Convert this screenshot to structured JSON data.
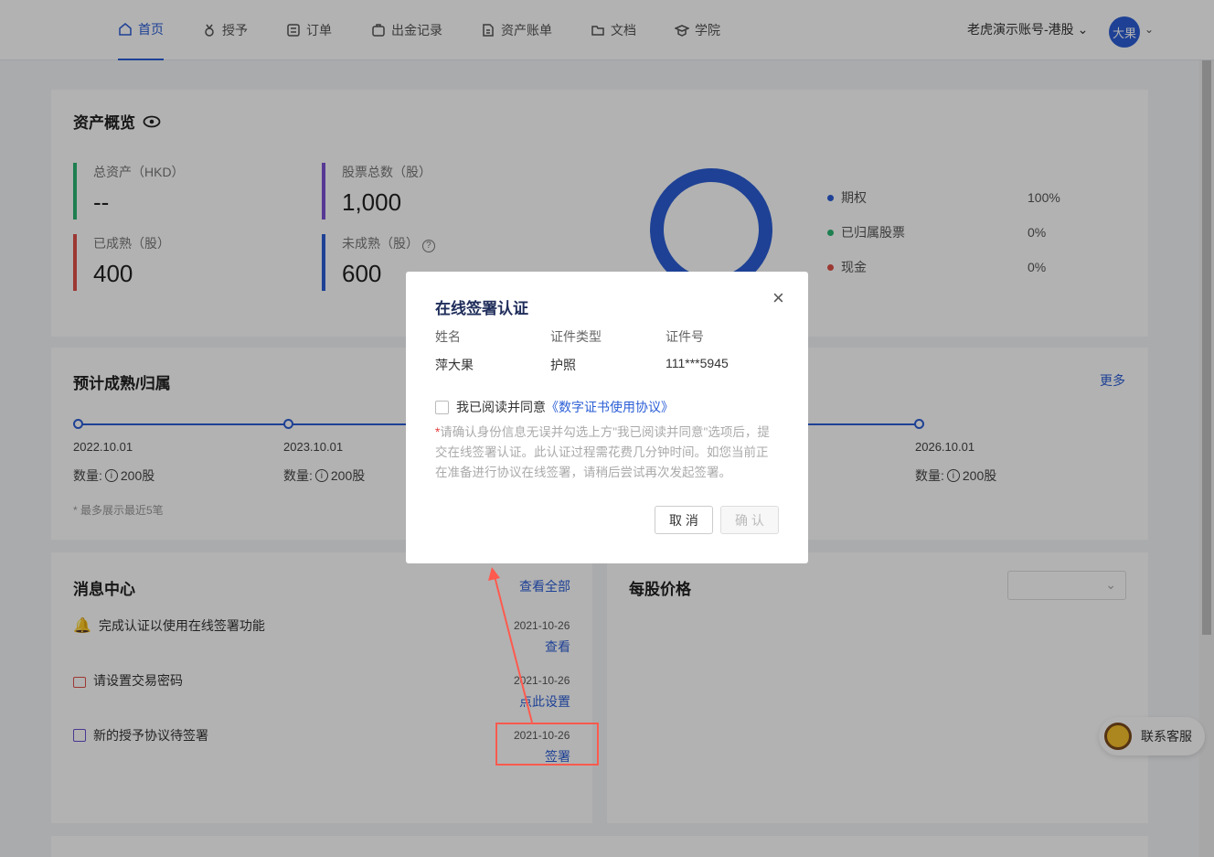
{
  "nav": {
    "items": [
      {
        "label": "首页",
        "icon": "home-icon",
        "active": true
      },
      {
        "label": "授予",
        "icon": "medal-icon"
      },
      {
        "label": "订单",
        "icon": "order-icon"
      },
      {
        "label": "出金记录",
        "icon": "wallet-icon"
      },
      {
        "label": "资产账单",
        "icon": "document-icon"
      },
      {
        "label": "文档",
        "icon": "folder-icon"
      },
      {
        "label": "学院",
        "icon": "graduation-icon"
      }
    ],
    "account": "老虎演示账号-港股",
    "avatar_text": "大果"
  },
  "overview": {
    "title": "资产概览",
    "stats": [
      {
        "label": "总资产（HKD）",
        "value": "--",
        "color": "#2bb673"
      },
      {
        "label": "股票总数（股）",
        "value": "1,000",
        "color": "#7b52d6"
      },
      {
        "label": "已成熟（股）",
        "value": "400",
        "color": "#e0514a"
      },
      {
        "label": "未成熟（股）",
        "value": "600",
        "color": "#2b5ed6"
      }
    ],
    "legend": [
      {
        "label": "期权",
        "pct": "100%",
        "color": "#2b5ed6"
      },
      {
        "label": "已归属股票",
        "pct": "0%",
        "color": "#2bb673"
      },
      {
        "label": "现金",
        "pct": "0%",
        "color": "#e0514a"
      }
    ]
  },
  "vesting": {
    "title": "预计成熟/归属",
    "more": "更多",
    "points": [
      {
        "date": "2022.10.01",
        "qty_label": "数量:",
        "qty": "200股"
      },
      {
        "date": "2023.10.01",
        "qty_label": "数量:",
        "qty": "200股"
      },
      {
        "date": "2026.10.01",
        "qty_label": "数量:",
        "qty": "200股"
      }
    ],
    "note": "* 最多展示最近5笔"
  },
  "messages": {
    "title": "消息中心",
    "view_all": "查看全部",
    "items": [
      {
        "text": "完成认证以使用在线签署功能",
        "date": "2021-10-26",
        "action": "查看",
        "icon": "bell-icon"
      },
      {
        "text": "请设置交易密码",
        "date": "2021-10-26",
        "action": "点此设置",
        "icon": "lock-icon"
      },
      {
        "text": "新的授予协议待签署",
        "date": "2021-10-26",
        "action": "签署",
        "icon": "edit-icon"
      }
    ]
  },
  "price": {
    "title": "每股价格"
  },
  "modal": {
    "title": "在线签署认证",
    "headers": [
      "姓名",
      "证件类型",
      "证件号"
    ],
    "values": [
      "萍大果",
      "护照",
      "111***5945"
    ],
    "agree_text": "我已阅读并同意",
    "agree_link": "《数字证书使用协议》",
    "notice_star": "*",
    "notice": "请确认身份信息无误并勾选上方\"我已阅读并同意\"选项后，提交在线签署认证。此认证过程需花费几分钟时间。如您当前正在准备进行协议在线签署，请稍后尝试再次发起签署。",
    "cancel": "取 消",
    "confirm": "确 认"
  },
  "support": {
    "label": "联系客服"
  }
}
